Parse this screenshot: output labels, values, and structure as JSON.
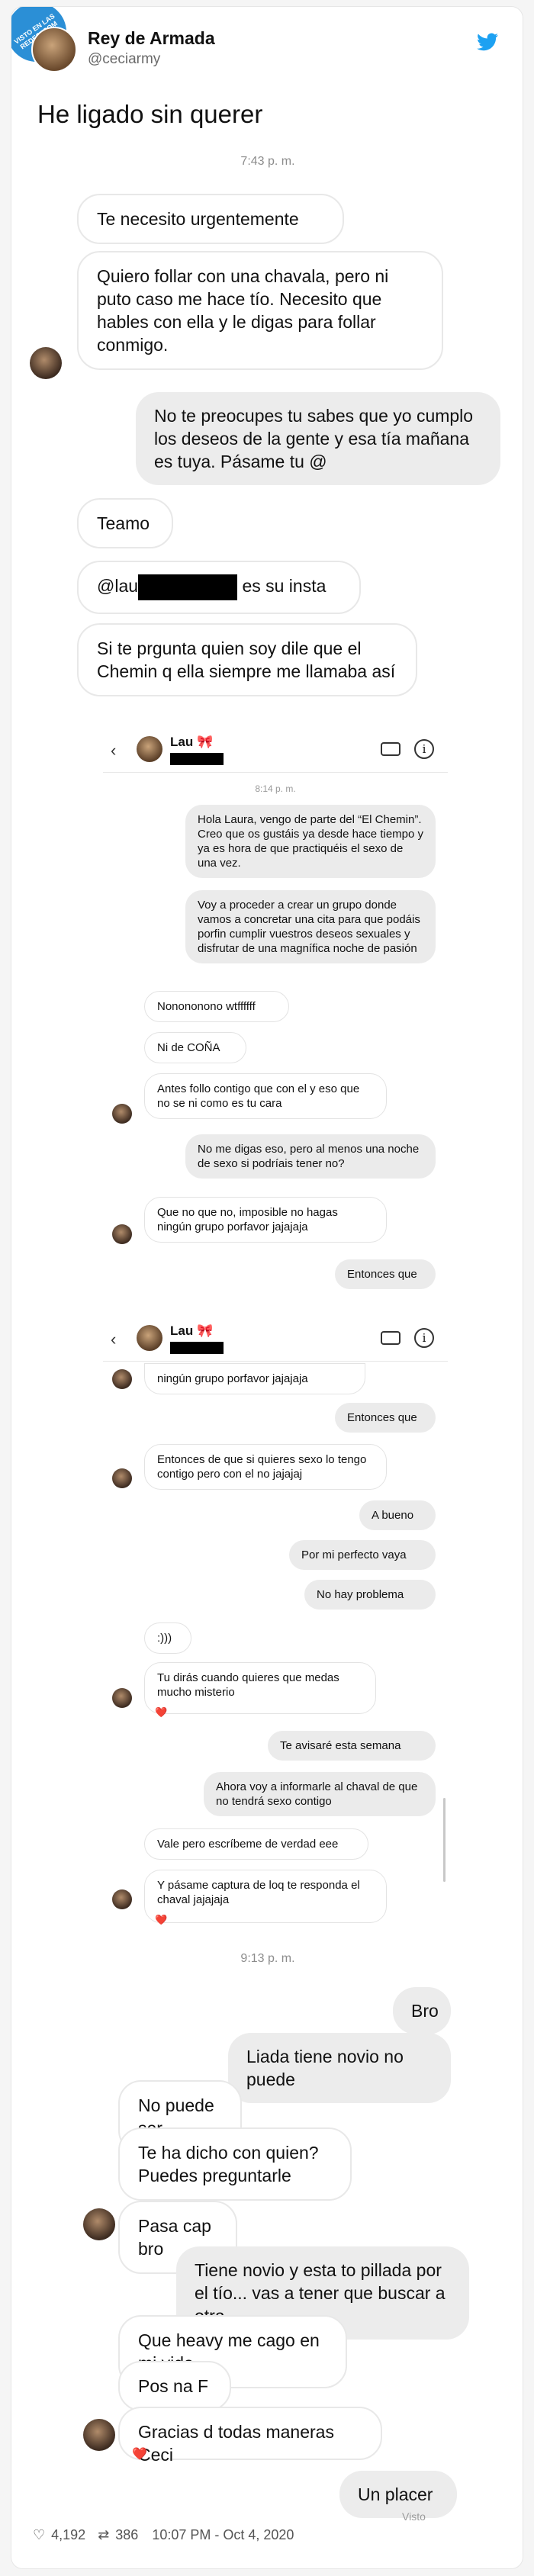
{
  "header": {
    "badge": "VISTO EN LAS REDES .COM",
    "author_name": "Rey de Armada",
    "author_handle": "@ceciarmy",
    "tweet_text": "He ligado sin querer"
  },
  "chat": {
    "time1": "7:43 p. m.",
    "m1": "Te necesito urgentemente",
    "m2": "Quiero follar con una chavala, pero ni puto caso me hace tío. Necesito que hables con ella y le digas para follar conmigo.",
    "m3": "No te preocupes tu sabes que yo cumplo los deseos de la gente y esa tía mañana es tuya. Pásame tu @",
    "m4": "Teamo",
    "m5_prefix": "@lau",
    "m5_suffix": "es su insta",
    "m6": "Si te prgunta quien soy dile que el Chemin q ella siempre me llamaba así",
    "time2": "9:13 p. m.",
    "m7": "Bro",
    "m8": "Liada tiene novio no puede",
    "m9": "No puede ser",
    "m10": "Te ha dicho con quien? Puedes preguntarle",
    "m11": "Pasa cap bro",
    "m12": "Tiene novio y esta to pillada por el tío... vas a tener que buscar a otra",
    "m13": "Que heavy me cago en mi vida",
    "m14": "Pos na F",
    "m15": "Gracias d todas maneras Ceci",
    "m16": "Un placer",
    "seen": "Visto"
  },
  "shot1": {
    "contact": "Lau 🎀",
    "time": "8:14 p. m.",
    "s1": "Hola Laura, vengo de parte del “El Chemin”. Creo que os gustáis ya desde hace tiempo y ya es hora de que practiquéis el sexo de una vez.",
    "s2": "Voy a proceder a crear un grupo donde vamos a concretar una cita para que podáis porfin cumplir vuestros deseos sexuales y disfrutar de una magnífica noche de pasión",
    "s3": "Nonononono wtffffff",
    "s4": "Ni de COÑA",
    "s5": "Antes follo contigo que con el y eso que no se ni como es tu cara",
    "s6": "No me digas eso, pero al menos una noche de sexo si podríais tener no?",
    "s7": "Que no que no, imposible no hagas ningún grupo porfavor jajajaja",
    "s8": "Entonces que"
  },
  "shot2": {
    "contact": "Lau 🎀",
    "s1": "ningún grupo porfavor jajajaja",
    "s2": "Entonces que",
    "s3": "Entonces de que si quieres sexo lo tengo contigo pero con el no jajajaj",
    "s4": "A bueno",
    "s5": "Por mi perfecto vaya",
    "s6": "No hay problema",
    "s7": ":)))",
    "s8": "Tu dirás cuando quieres que medas mucho misterio",
    "s9": "Te avisaré esta semana",
    "s10": "Ahora voy a informarle al chaval de que no tendrá sexo contigo",
    "s11": "Vale pero escríbeme de verdad eee",
    "s12": "Y pásame captura de loq te responda el chaval jajajaja"
  },
  "footer": {
    "likes": "4,192",
    "retweets": "386",
    "timestamp": "10:07 PM - Oct 4, 2020"
  },
  "colors": {
    "twitter_blue": "#1da1f2",
    "heart": "#e0245e"
  }
}
